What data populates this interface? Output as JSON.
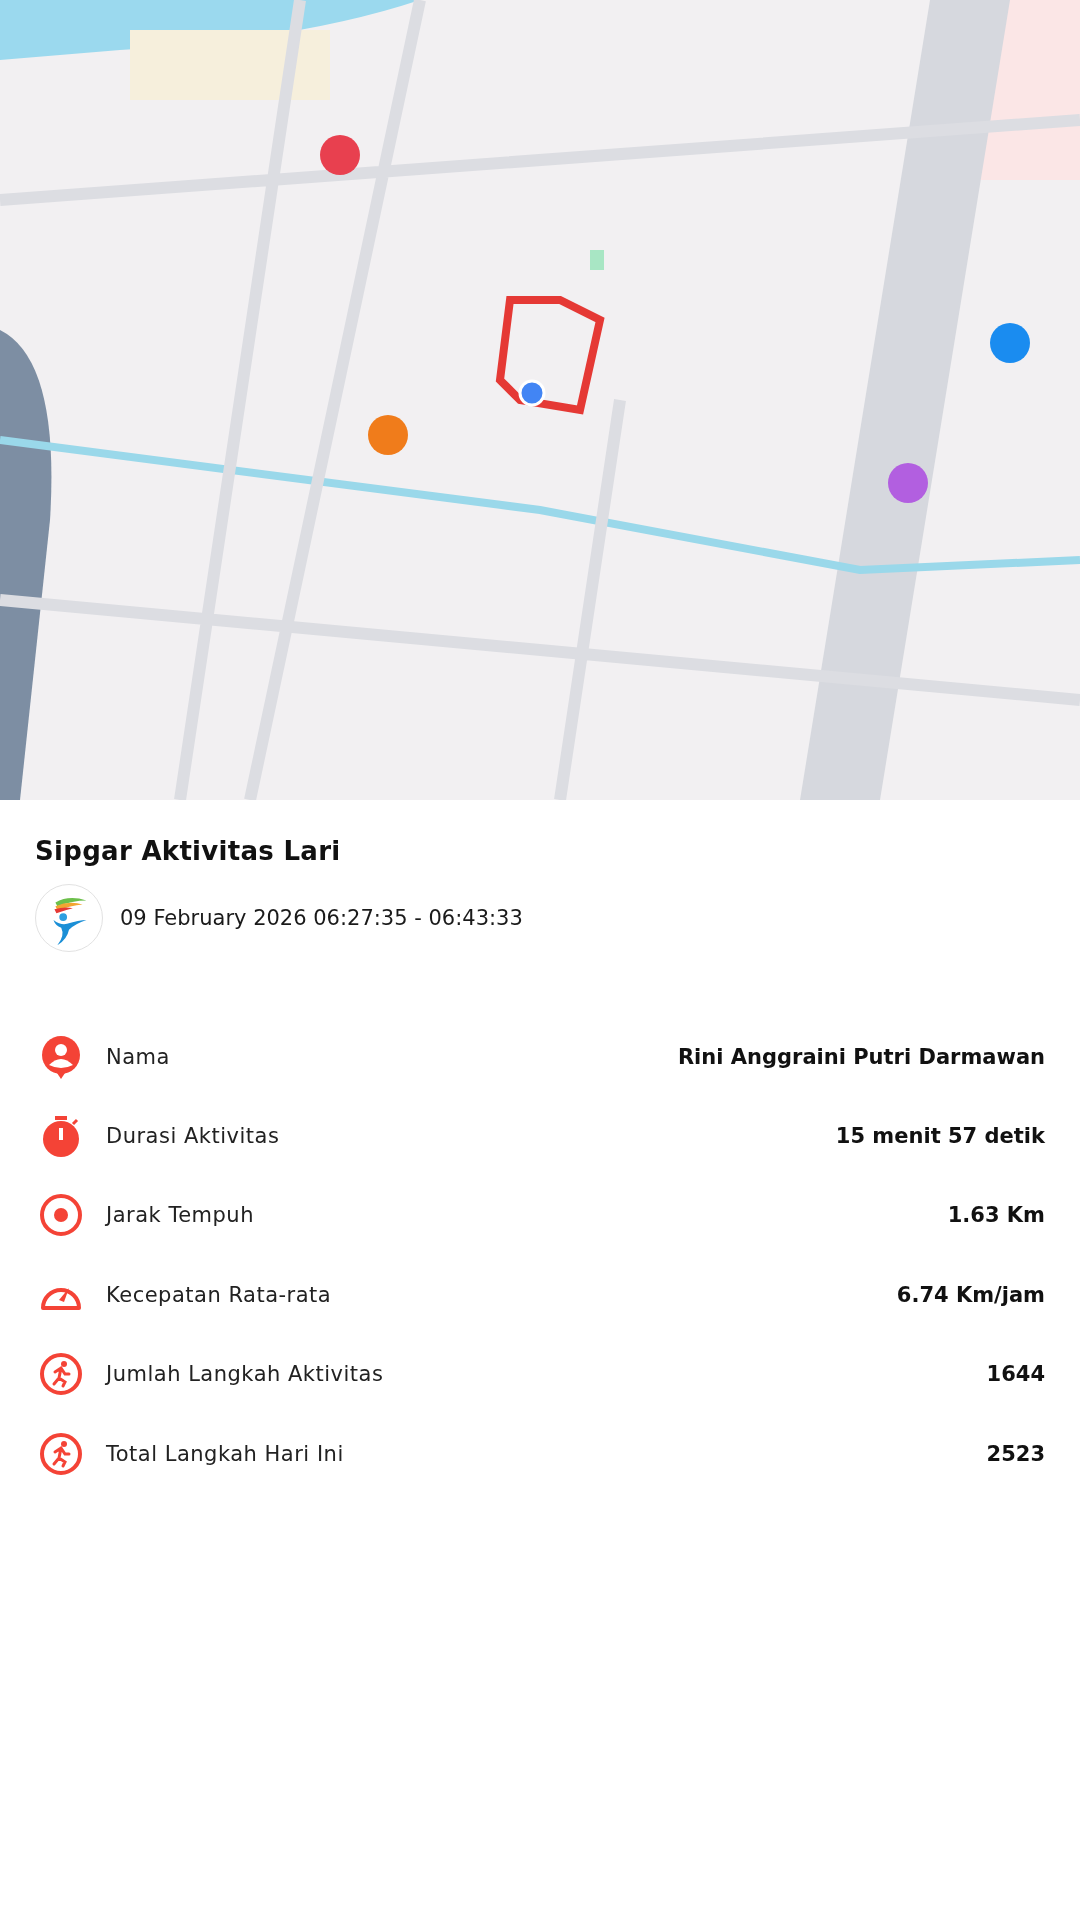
{
  "activity": {
    "title": "Sipgar Aktivitas Lari",
    "datetime": "09 February 2026 06:27:35 - 06:43:33"
  },
  "stats": [
    {
      "kind": "person",
      "label": "Nama",
      "value": "Rini Anggraini Putri Darmawan"
    },
    {
      "kind": "stopwatch",
      "label": "Durasi Aktivitas",
      "value": "15 menit 57 detik"
    },
    {
      "kind": "target",
      "label": "Jarak Tempuh",
      "value": "1.63 Km"
    },
    {
      "kind": "gauge",
      "label": "Kecepatan Rata-rata",
      "value": "6.74 Km/jam"
    },
    {
      "kind": "runner",
      "label": "Jumlah Langkah Aktivitas",
      "value": "1644"
    },
    {
      "kind": "runner",
      "label": "Total Langkah Hari Ini",
      "value": "2523"
    }
  ]
}
